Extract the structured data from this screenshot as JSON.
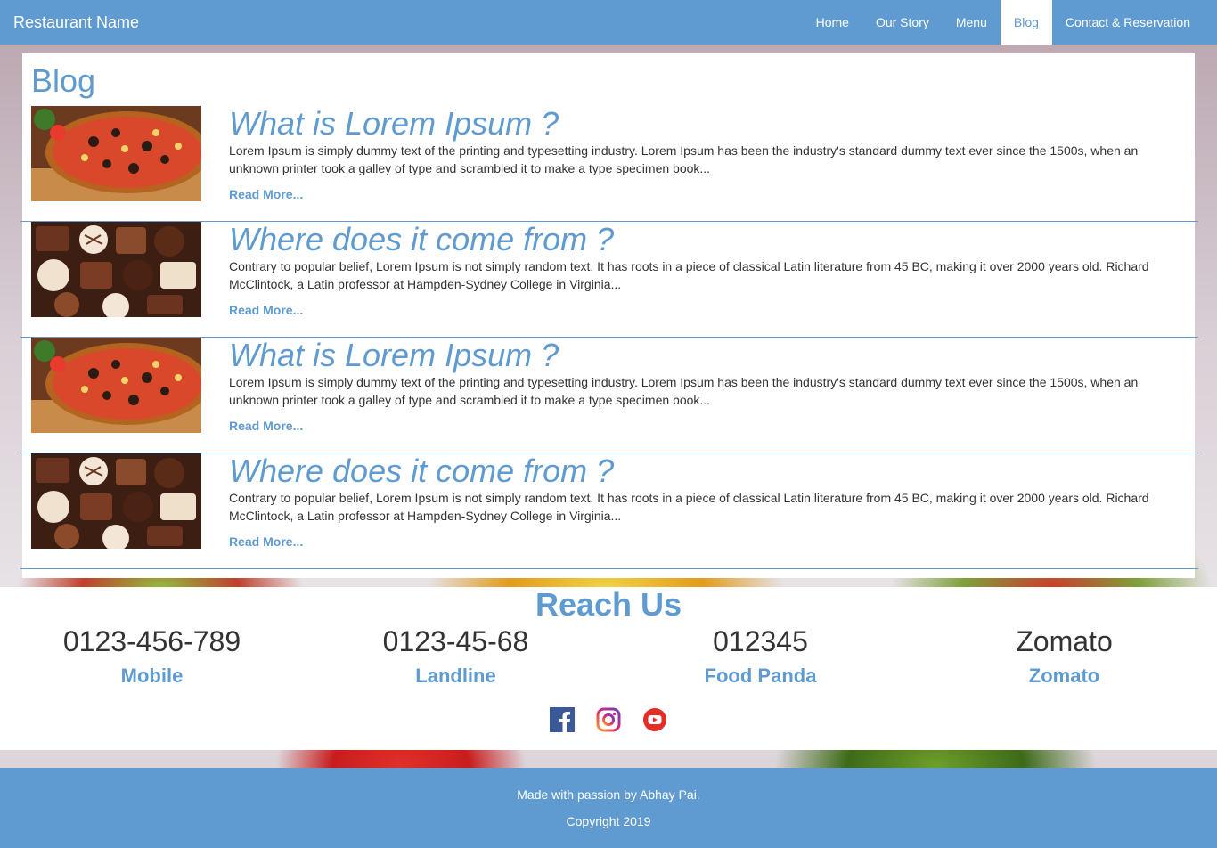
{
  "navbar": {
    "brand": "Restaurant Name",
    "items": [
      {
        "label": "Home",
        "active": false
      },
      {
        "label": "Our Story",
        "active": false
      },
      {
        "label": "Menu",
        "active": false
      },
      {
        "label": "Blog",
        "active": true
      },
      {
        "label": "Contact & Reservation",
        "active": false
      }
    ]
  },
  "blog": {
    "title": "Blog",
    "posts": [
      {
        "image": "pizza-image",
        "title": "What is Lorem Ipsum ?",
        "excerpt": "Lorem Ipsum is simply dummy text of the printing and typesetting industry. Lorem Ipsum has been the industry's standard dummy text ever since the 1500s, when an unknown printer took a galley of type and scrambled it to make a type specimen book...",
        "read_more": "Read More..."
      },
      {
        "image": "chocolates-image",
        "title": "Where does it come from ?",
        "excerpt": "Contrary to popular belief, Lorem Ipsum is not simply random text. It has roots in a piece of classical Latin literature from 45 BC, making it over 2000 years old. Richard McClintock, a Latin professor at Hampden-Sydney College in Virginia...",
        "read_more": "Read More..."
      },
      {
        "image": "pizza-image",
        "title": "What is Lorem Ipsum ?",
        "excerpt": "Lorem Ipsum is simply dummy text of the printing and typesetting industry. Lorem Ipsum has been the industry's standard dummy text ever since the 1500s, when an unknown printer took a galley of type and scrambled it to make a type specimen book...",
        "read_more": "Read More..."
      },
      {
        "image": "chocolates-image",
        "title": "Where does it come from ?",
        "excerpt": "Contrary to popular belief, Lorem Ipsum is not simply random text. It has roots in a piece of classical Latin literature from 45 BC, making it over 2000 years old. Richard McClintock, a Latin professor at Hampden-Sydney College in Virginia...",
        "read_more": "Read More..."
      }
    ]
  },
  "reach": {
    "title": "Reach Us",
    "contacts": [
      {
        "value": "0123-456-789",
        "label": "Mobile"
      },
      {
        "value": "0123-45-68",
        "label": "Landline"
      },
      {
        "value": "012345",
        "label": "Food Panda"
      },
      {
        "value": "Zomato",
        "label": "Zomato"
      }
    ],
    "socials": [
      "facebook-icon",
      "instagram-icon",
      "youtube-icon"
    ]
  },
  "footer": {
    "made_with": "Made with passion by Abhay Pai.",
    "copyright": "Copyright 2019"
  },
  "colors": {
    "accent": "#5f9bd0",
    "text": "#333333",
    "facebook": "#3b5998",
    "youtube": "#e52d27"
  }
}
